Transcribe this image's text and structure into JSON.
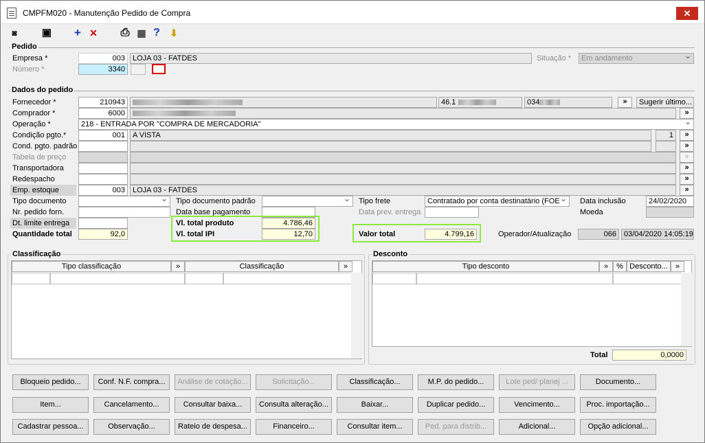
{
  "window": {
    "title": "CMPFM020 - Manutenção Pedido de Compra",
    "close_label": "✕"
  },
  "toolbar": {
    "back": "◙",
    "save": "▣",
    "add": "+",
    "delete": "✕",
    "print": "⎙",
    "calc": "▦",
    "help": "?",
    "exit": "⬇"
  },
  "pedido": {
    "title": "Pedido",
    "empresa_label": "Empresa *",
    "empresa_code": "003",
    "empresa_name": "LOJA 03 - FATDES",
    "numero_label": "Número *",
    "numero_value": "3340",
    "situacao_label": "Situação *",
    "situacao_value": "Em andamento"
  },
  "dados": {
    "title": "Dados do pedido",
    "fornecedor_label": "Fornecedor *",
    "fornecedor_code": "210943",
    "fornecedor_cnpj": "46.1",
    "fornecedor_extra": "034",
    "sugerir_label": "Sugerir último...",
    "comprador_label": "Comprador *",
    "comprador_code": "6000",
    "operacao_label": "Operação *",
    "operacao_value": "218 - ENTRADA POR \"COMPRA DE MERCADORIA\"",
    "condicao_label": "Condição pgto.*",
    "condicao_code": "001",
    "condicao_name": "A VISTA",
    "condicao_parcelas": "1",
    "cond_padrao_label": "Cond. pgto. padrão",
    "tabela_label": "Tabela de preço",
    "transportadora_label": "Transportadora",
    "redespacho_label": "Redespacho",
    "emp_estoque_label": "Emp. estoque",
    "emp_estoque_code": "003",
    "emp_estoque_name": "LOJA 03 - FATDES",
    "tipo_doc_label": "Tipo documento",
    "tipo_doc_padrao_label": "Tipo documento padrão",
    "tipo_frete_label": "Tipo frete",
    "tipo_frete_value": "Contratado por conta destinatário (FOE",
    "data_inclusao_label": "Data inclusão",
    "data_inclusao_value": "24/02/2020",
    "nr_pedido_label": "Nr. pedido forn.",
    "data_base_label": "Data base pagamento",
    "data_prev_label": "Data prev. entrega",
    "moeda_label": "Moeda",
    "dt_limite_label": "Dt. limite entrega",
    "vl_produto_label": "Vl. total produto",
    "vl_produto_value": "4.786,46",
    "vl_ipi_label": "Vl. total IPI",
    "vl_ipi_value": "12,70",
    "quantidade_label": "Quantidade total",
    "quantidade_value": "92,0",
    "valor_total_label": "Valor total",
    "valor_total_value": "4.799,16",
    "operador_label": "Operador/Atualização",
    "operador_code": "066",
    "operador_datetime": "03/04/2020 14:05:19",
    "more": "»"
  },
  "classificacao": {
    "title": "Classificação",
    "col1": "Tipo classificação",
    "col2": "Classificação",
    "more": "»"
  },
  "desconto": {
    "title": "Desconto",
    "col1": "Tipo desconto",
    "col2": "%",
    "col3": "Desconto...",
    "more": "»",
    "total_label": "Total",
    "total_value": "0,0000"
  },
  "buttons": [
    [
      "Bloqueio pedido...",
      "Conf. N.F. compra...",
      "Análise de cotação...",
      "Solicitação...",
      "Classificação...",
      "M.P. do pedido...",
      "Lote ped/ planej ...",
      "Documento..."
    ],
    [
      "Item...",
      "Cancelamento...",
      "Consultar baixa...",
      "Consulta alteração...",
      "Baixar...",
      "Duplicar pedido...",
      "Vencimento...",
      "Proc. importação..."
    ],
    [
      "Cadastrar pessoa...",
      "Observação...",
      "Rateio de despesa...",
      "Financeiro...",
      "Consultar item...",
      "Ped. para distrib...",
      "Adicional...",
      "Opção adicional..."
    ]
  ]
}
